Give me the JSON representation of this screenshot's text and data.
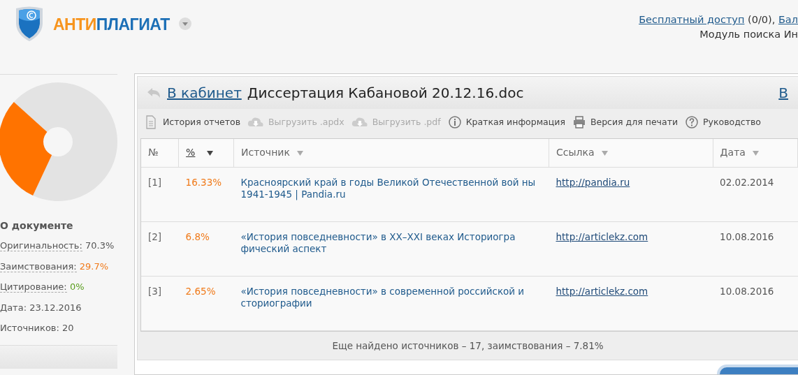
{
  "header": {
    "logo": {
      "accent": "АНТИ",
      "main": "ПЛАГИАТ"
    },
    "account": {
      "free_access_link": "Бесплатный доступ",
      "free_access_count": "(0/0),",
      "balance_link": "Бал",
      "module": "Модуль поиска Ин"
    }
  },
  "sidebar": {
    "title": "О документе",
    "stats": [
      {
        "label": "Оригинальность:",
        "value": "70.3%",
        "color": "#555555",
        "hint": true
      },
      {
        "label": "Заимствования:",
        "value": "29.7%",
        "color": "#f07a1a",
        "hint": true
      },
      {
        "label": "Цитирование:",
        "value": "0%",
        "color": "#5a9e1e",
        "hint": true
      },
      {
        "label": "Дата:",
        "value": "23.12.2016",
        "color": "#555555",
        "hint": false
      },
      {
        "label": "Источников:",
        "value": "20",
        "color": "#555555",
        "hint": false
      }
    ]
  },
  "report": {
    "back_link": "В кабинет",
    "title": "Диссертация Кабановой 20.12.16.doc",
    "right_link": "В",
    "toolbar": [
      {
        "kind": "document",
        "label": "История отчетов",
        "disabled": false
      },
      {
        "kind": "download",
        "label": "Выгрузить .apdx",
        "disabled": true
      },
      {
        "kind": "download",
        "label": "Выгрузить .pdf",
        "disabled": true
      },
      {
        "kind": "info",
        "label": "Краткая информация",
        "disabled": false
      },
      {
        "kind": "print",
        "label": "Версия для печати",
        "disabled": false
      },
      {
        "kind": "help",
        "label": "Руководство",
        "disabled": false
      }
    ],
    "table": {
      "columns": [
        {
          "label": "№",
          "sortable": false,
          "sorted": false
        },
        {
          "label": "%",
          "sortable": true,
          "sorted": true
        },
        {
          "label": "Источник",
          "sortable": true,
          "sorted": false
        },
        {
          "label": "Ссылка",
          "sortable": true,
          "sorted": false
        },
        {
          "label": "Дата",
          "sortable": true,
          "sorted": false
        }
      ],
      "rows": [
        {
          "number": "[1]",
          "percent": "16.33%",
          "source": "Красноярский край в годы Великой Отечественной вой ны 1941-1945 | Pandia.ru",
          "link": "http://pandia.ru",
          "date": "02.02.2014"
        },
        {
          "number": "[2]",
          "percent": "6.8%",
          "source": "«История повседневности» в XX–XXI веках Историогра фический аспект",
          "link": "http://articlekz.com",
          "date": "10.08.2016"
        },
        {
          "number": "[3]",
          "percent": "2.65%",
          "source": "«История повседневности» в современной российской и сториографии",
          "link": "http://articlekz.com",
          "date": "10.08.2016"
        }
      ]
    },
    "footer": "Еще найдено источников – 17, заимствования – 7.81%"
  }
}
